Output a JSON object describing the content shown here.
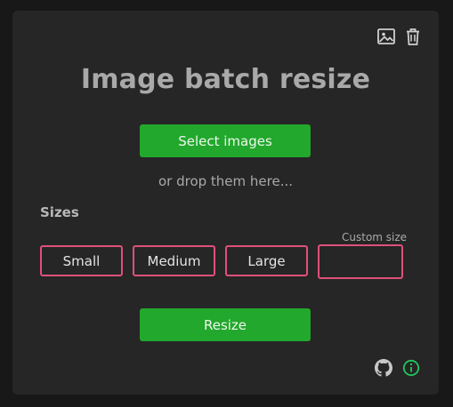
{
  "header": {
    "title": "Image batch resize",
    "icons": [
      "image-icon",
      "trash-icon"
    ]
  },
  "upload": {
    "select_label": "Select images",
    "drop_hint": "or drop them here..."
  },
  "sizes": {
    "label": "Sizes",
    "custom_label": "Custom size",
    "custom_value": "",
    "options": [
      "Small",
      "Medium",
      "Large"
    ]
  },
  "actions": {
    "resize_label": "Resize"
  },
  "footer": {
    "icons": [
      "github-icon",
      "info-icon"
    ]
  },
  "colors": {
    "background": "#262626",
    "accent_green": "#22a82c",
    "size_border": "#e0507a",
    "info_green": "#22c55e"
  }
}
